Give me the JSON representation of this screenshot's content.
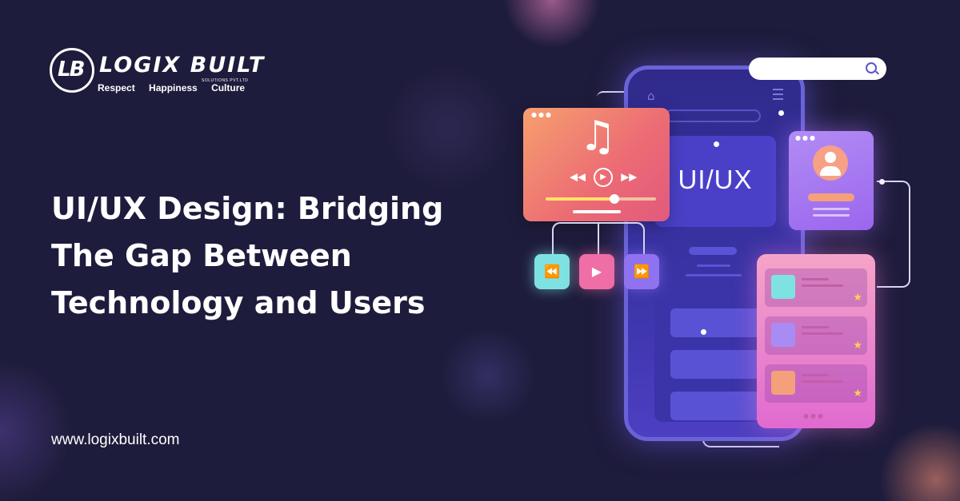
{
  "logo": {
    "monogram": "LB",
    "name": "LOGIX BUILT",
    "subtitle": "SOLUTIONS PVT.LTD",
    "values": [
      "Respect",
      "Happiness",
      "Culture"
    ]
  },
  "headline": {
    "line1": "UI/UX Design: Bridging",
    "line2": "The Gap Between",
    "line3": "Technology and Users"
  },
  "website": "www.logixbuilt.com",
  "illustration": {
    "ui_label": "UI/UX",
    "music_icon": "music-note-icon",
    "controls": {
      "rewind": "⏪",
      "play": "▶",
      "forward": "⏩"
    },
    "colors": {
      "background": "#1e1c3c",
      "phone": "#6a63d8",
      "music_card": "#ec6a74",
      "profile_card": "#9b66ee",
      "list_card": "#e06ad0"
    }
  }
}
